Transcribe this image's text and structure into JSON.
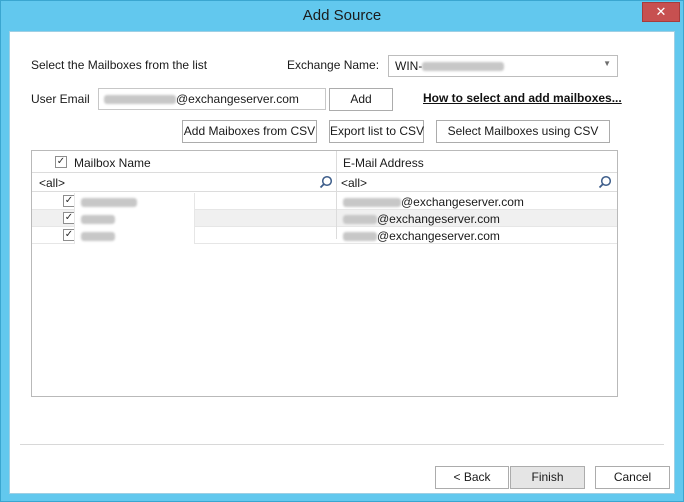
{
  "window": {
    "title": "Add Source",
    "close_glyph": "✕"
  },
  "labels": {
    "select_mailboxes": "Select the Mailboxes from the list",
    "exchange_name": "Exchange Name:",
    "user_email": "User Email"
  },
  "exchange_combo": {
    "value_prefix": "WIN-",
    "arrow_glyph": "▼"
  },
  "user_email_field": {
    "value_suffix": "@exchangeserver.com"
  },
  "buttons": {
    "add": "Add",
    "how_to_link": "How to select and add mailboxes...",
    "add_from_csv": "Add Maiboxes from CSV",
    "export_csv": "Export list to CSV",
    "select_csv": "Select Mailboxes using CSV",
    "back": "< Back",
    "finish": "Finish",
    "cancel": "Cancel"
  },
  "grid": {
    "columns": [
      "Mailbox Name",
      "E-Mail Address"
    ],
    "filter_name": "<all>",
    "filter_email": "<all>",
    "rows": [
      {
        "checked": true,
        "email_suffix": "@exchangeserver.com"
      },
      {
        "checked": true,
        "email_suffix": "@exchangeserver.com"
      },
      {
        "checked": true,
        "email_suffix": "@exchangeserver.com"
      }
    ]
  },
  "icons": {
    "checkbox": "checkbox-checked-icon",
    "search": "magnifier-icon",
    "check_glyph": "✓"
  }
}
